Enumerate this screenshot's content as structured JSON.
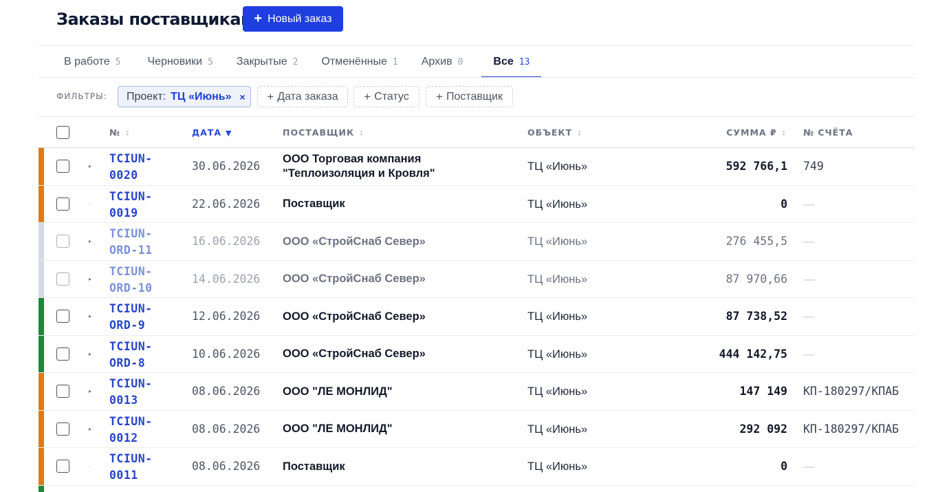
{
  "header": {
    "title": "Заказы поставщикам",
    "new_button_label": "Новый заказ"
  },
  "tabs": [
    {
      "label": "В работе",
      "count": "5",
      "active": false
    },
    {
      "label": "Черновики",
      "count": "5",
      "active": false
    },
    {
      "label": "Закрытые",
      "count": "2",
      "active": false
    },
    {
      "label": "Отменённые",
      "count": "1",
      "active": false
    },
    {
      "label": "Архив",
      "count": "0",
      "active": false
    },
    {
      "label": "Все",
      "count": "13",
      "active": true
    }
  ],
  "filters": {
    "label": "ФИЛЬТРЫ:",
    "project_chip": {
      "label": "Проект:",
      "value": "ТЦ «Июнь»",
      "remove": "×"
    },
    "add_chips": [
      "Дата заказа",
      "Статус",
      "Поставщик"
    ]
  },
  "table": {
    "columns": {
      "num": "№",
      "date": "ДАТА",
      "supplier": "ПОСТАВЩИК",
      "object": "ОБЪЕКТ",
      "sum": "СУММА ₽",
      "invoice": "№ СЧЁТА"
    },
    "sorted_by": "date",
    "sort_direction": "desc",
    "status_colors": {
      "in_work": "#e07b12",
      "cancelled": "#d5d9e2",
      "closed": "#198a3c"
    },
    "rows": [
      {
        "num_1": "TCIUN-",
        "num_2": "0020",
        "date": "30.06.2026",
        "supplier": "ООО Торговая компания \"Теплоизоляция и Кровля\"",
        "object": "ТЦ «Июнь»",
        "sum": "592 766,1",
        "invoice": "749",
        "status": "in_work",
        "muted": false,
        "expandable": true
      },
      {
        "num_1": "TCIUN-",
        "num_2": "0019",
        "date": "22.06.2026",
        "supplier": "Поставщик",
        "object": "ТЦ «Июнь»",
        "sum": "0",
        "invoice": "—",
        "status": "in_work",
        "muted": false,
        "expandable": false
      },
      {
        "num_1": "TCIUN-",
        "num_2": "ORD-11",
        "date": "16.06.2026",
        "supplier": "ООО «СтройСнаб Север»",
        "object": "ТЦ «Июнь»",
        "sum": "276 455,5",
        "invoice": "—",
        "status": "cancelled",
        "muted": true,
        "expandable": true
      },
      {
        "num_1": "TCIUN-",
        "num_2": "ORD-10",
        "date": "14.06.2026",
        "supplier": "ООО «СтройСнаб Север»",
        "object": "ТЦ «Июнь»",
        "sum": "87 970,66",
        "invoice": "—",
        "status": "cancelled",
        "muted": true,
        "expandable": true
      },
      {
        "num_1": "TCIUN-",
        "num_2": "ORD-9",
        "date": "12.06.2026",
        "supplier": "ООО «СтройСнаб Север»",
        "object": "ТЦ «Июнь»",
        "sum": "87 738,52",
        "invoice": "—",
        "status": "closed",
        "muted": false,
        "expandable": true
      },
      {
        "num_1": "TCIUN-",
        "num_2": "ORD-8",
        "date": "10.06.2026",
        "supplier": "ООО «СтройСнаб Север»",
        "object": "ТЦ «Июнь»",
        "sum": "444 142,75",
        "invoice": "—",
        "status": "closed",
        "muted": false,
        "expandable": true
      },
      {
        "num_1": "TCIUN-",
        "num_2": "0013",
        "date": "08.06.2026",
        "supplier": "ООО \"ЛЕ МОНЛИД\"",
        "object": "ТЦ «Июнь»",
        "sum": "147 149",
        "invoice": "КП-180297/КПАБ",
        "status": "in_work",
        "muted": false,
        "expandable": true
      },
      {
        "num_1": "TCIUN-",
        "num_2": "0012",
        "date": "08.06.2026",
        "supplier": "ООО \"ЛЕ МОНЛИД\"",
        "object": "ТЦ «Июнь»",
        "sum": "292 092",
        "invoice": "КП-180297/КПАБ",
        "status": "in_work",
        "muted": false,
        "expandable": true
      },
      {
        "num_1": "TCIUN-",
        "num_2": "0011",
        "date": "08.06.2026",
        "supplier": "Поставщик",
        "object": "ТЦ «Июнь»",
        "sum": "0",
        "invoice": "—",
        "status": "in_work",
        "muted": false,
        "expandable": false
      }
    ]
  }
}
